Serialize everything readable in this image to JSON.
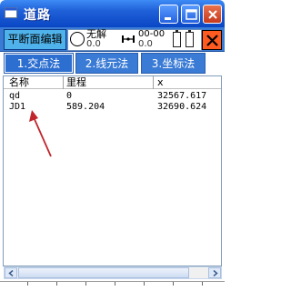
{
  "window": {
    "title": "道路"
  },
  "toolbar": {
    "mode_label": "平断面编辑",
    "solution_status": "无解",
    "solution_value": "0.0",
    "time_text": "00-00",
    "time_value": "0.0"
  },
  "tabs": [
    {
      "label": "1.交点法",
      "active": true
    },
    {
      "label": "2.线元法",
      "active": false
    },
    {
      "label": "3.坐标法",
      "active": false
    }
  ],
  "table": {
    "columns": [
      "名称",
      "里程",
      "x"
    ],
    "rows": [
      [
        "qd",
        "0",
        "32567.617"
      ],
      [
        "JD1",
        "589.204",
        "32690.624"
      ]
    ]
  },
  "colors": {
    "titlebar": "#0a46c4",
    "toolbar": "#3a7bd5",
    "mode_label_bg": "#4fb2ea",
    "close_panel": "#ff5a1f",
    "annotation_arrow": "#c0262c"
  }
}
